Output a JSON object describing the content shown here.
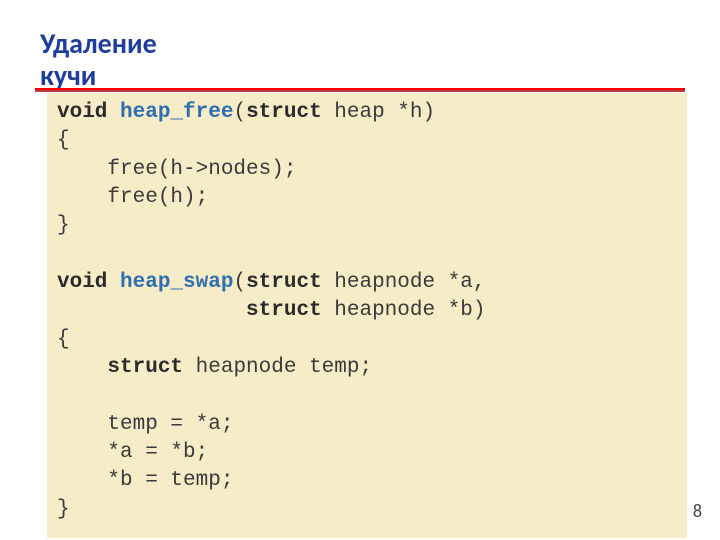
{
  "slide": {
    "title_line1": "Удаление",
    "title_line2": "кучи",
    "page_number": "8"
  },
  "code": {
    "tok": {
      "void": "void",
      "struct": "struct",
      "heap_free": "heap_free",
      "heap_swap": "heap_swap"
    },
    "l1_a": " heap *h)",
    "l1_p": "(",
    "l2": "{",
    "l3": "    free(h->nodes);",
    "l4": "    free(h);",
    "l5": "}",
    "l6": "",
    "l7_a": " heapnode *a,",
    "l7_p": "(",
    "l8_pad": "               ",
    "l8_a": " heapnode *b)",
    "l9": "{",
    "l10_pad": "    ",
    "l10_a": " heapnode temp;",
    "l11": "",
    "l12": "    temp = *a;",
    "l13": "    *a = *b;",
    "l14": "    *b = temp;",
    "l15": "}"
  }
}
